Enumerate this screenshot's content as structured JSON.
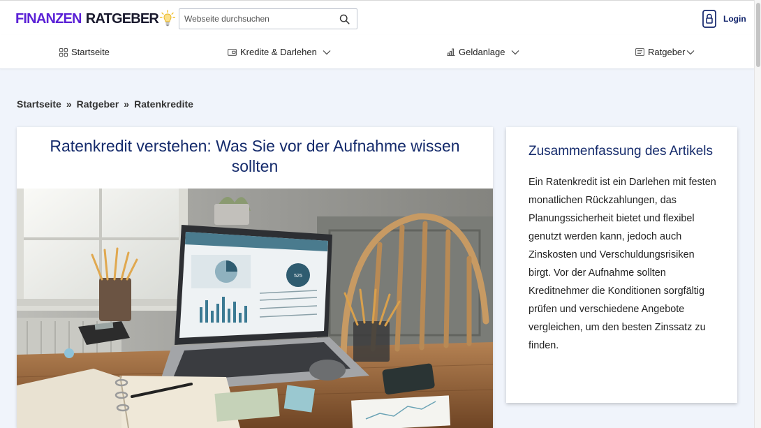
{
  "header": {
    "logo_part1": "FINANZEN",
    "logo_part2": "RATGEBER",
    "search_placeholder": "Webseite durchsuchen",
    "login_label": "Login"
  },
  "nav": {
    "items": [
      {
        "label": "Startseite",
        "icon": "grid-icon",
        "has_dropdown": false
      },
      {
        "label": "Kredite & Darlehen",
        "icon": "wallet-icon",
        "has_dropdown": true
      },
      {
        "label": "Geldanlage",
        "icon": "bar-chart-icon",
        "has_dropdown": true
      },
      {
        "label": "Ratgeber",
        "icon": "list-icon",
        "has_dropdown": true
      }
    ]
  },
  "breadcrumb": {
    "items": [
      "Startseite",
      "Ratgeber",
      "Ratenkredite"
    ],
    "separator": "»"
  },
  "article": {
    "title": "Ratenkredit verstehen: Was Sie vor der Aufnahme wissen sollten",
    "laptop_score": "525"
  },
  "summary": {
    "heading": "Zusammenfassung des Artikels",
    "text": "Ein Ratenkredit ist ein Darlehen mit festen monatlichen Rückzahlungen, das Planungssicherheit bietet und flexibel genutzt werden kann, jedoch auch Zinskosten und Verschuldungsrisiken birgt. Vor der Aufnahme sollten Kreditnehmer die Konditionen sorgfältig prüfen und verschiedene Angebote vergleichen, um den besten Zinssatz zu finden."
  },
  "colors": {
    "brand_purple": "#5b21d6",
    "brand_navy": "#142a6b",
    "page_bg": "#f0f4fb"
  }
}
